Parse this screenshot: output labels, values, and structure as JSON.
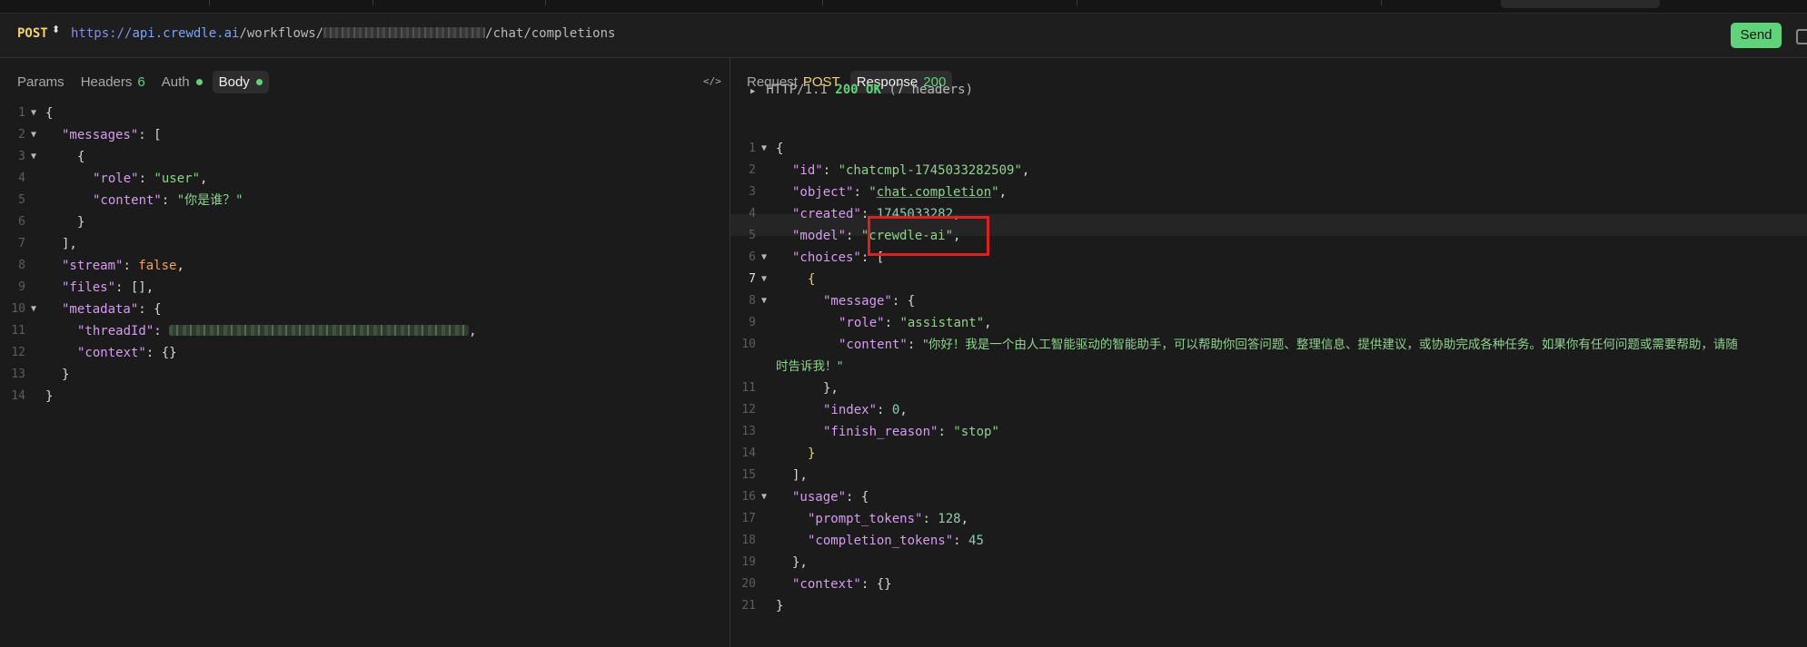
{
  "request": {
    "method": "POST",
    "method_caret": "⬍",
    "url": {
      "proto": "https://",
      "host": "api.crewdle.ai",
      "path1": "/workflows/",
      "path2": "/chat/completions"
    },
    "send_label": "Send"
  },
  "left_tabs": {
    "params": "Params",
    "headers": "Headers",
    "headers_count": "6",
    "auth": "Auth",
    "body": "Body",
    "code_icon": "</>"
  },
  "right_tabs": {
    "request": "Request",
    "request_method": "POST",
    "response": "Response",
    "response_status": "200"
  },
  "http_status": {
    "version": "HTTP/1.1",
    "code": "200 OK",
    "headers": "(7 headers)"
  },
  "request_body": {
    "line_numbers": [
      "1",
      "2",
      "3",
      "4",
      "5",
      "6",
      "7",
      "8",
      "9",
      "10",
      "11",
      "12",
      "13",
      "14"
    ],
    "text": {
      "messages": "\"messages\"",
      "role": "\"role\"",
      "user": "\"user\"",
      "content": "\"content\"",
      "content_val": "\"你是谁？\"",
      "stream": "\"stream\"",
      "false": "false",
      "files": "\"files\"",
      "metadata": "\"metadata\"",
      "threadId": "\"threadId\"",
      "context": "\"context\""
    }
  },
  "response_body": {
    "line_numbers": [
      "1",
      "2",
      "3",
      "4",
      "5",
      "6",
      "7",
      "8",
      "9",
      "10",
      "",
      "11",
      "12",
      "13",
      "14",
      "15",
      "16",
      "17",
      "18",
      "19",
      "20",
      "21"
    ],
    "text": {
      "id": "\"id\"",
      "id_val": "\"chatcmpl-1745033282509\"",
      "object": "\"object\"",
      "object_val": "chat.completion",
      "created": "\"created\"",
      "created_val": "1745033282",
      "model": "\"model\"",
      "model_val": "\"crewdle-ai\"",
      "choices": "\"choices\"",
      "message": "\"message\"",
      "role": "\"role\"",
      "role_val": "\"assistant\"",
      "content": "\"content\"",
      "content_val_1": "\"你好！我是一个由人工智能驱动的智能助手，可以帮助你回答问题、整理信息、提供建议，或协助完成各种任务。如果你有任何问题或需要帮助，请随",
      "content_val_2": "时告诉我！\"",
      "index": "\"index\"",
      "index_val": "0",
      "finish_reason": "\"finish_reason\"",
      "finish_reason_val": "\"stop\"",
      "usage": "\"usage\"",
      "prompt_tokens": "\"prompt_tokens\"",
      "prompt_tokens_val": "128",
      "completion_tokens": "\"completion_tokens\"",
      "completion_tokens_val": "45",
      "context": "\"context\""
    }
  },
  "colors": {
    "accent_green": "#5ed37a",
    "method_yellow": "#f3d36b",
    "highlight_red": "#e21f1f"
  }
}
